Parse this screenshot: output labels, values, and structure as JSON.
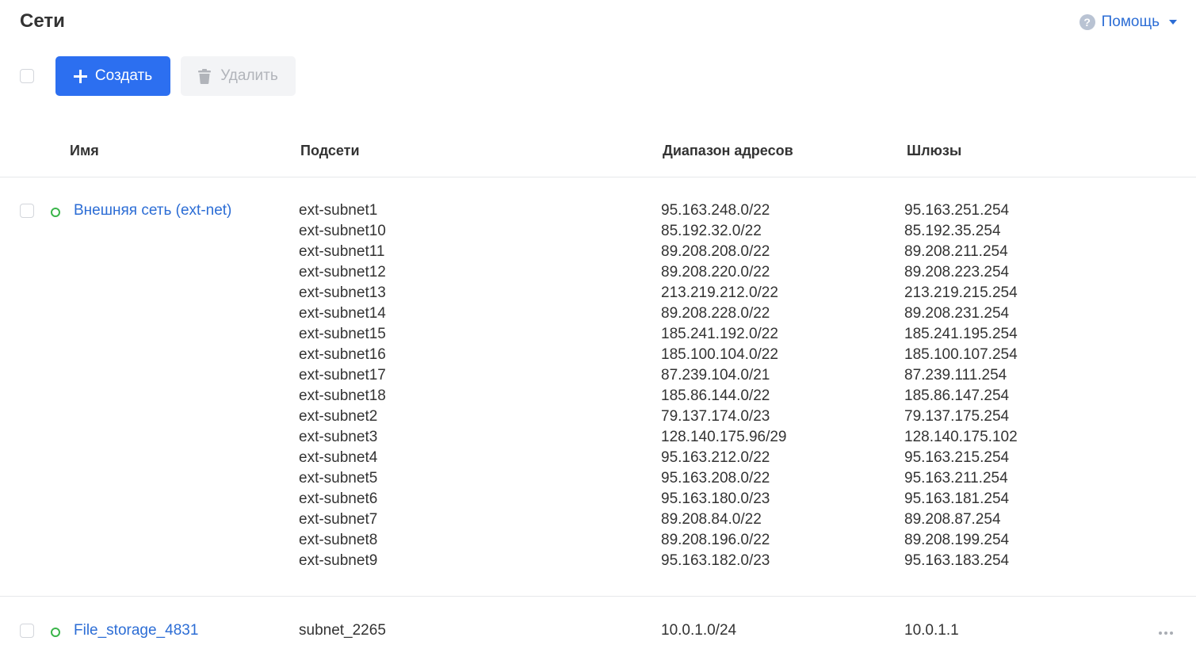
{
  "header": {
    "title": "Сети",
    "help_label": "Помощь"
  },
  "toolbar": {
    "create_label": "Создать",
    "delete_label": "Удалить"
  },
  "table": {
    "columns": [
      "Имя",
      "Подсети",
      "Диапазон адресов",
      "Шлюзы"
    ],
    "rows": [
      {
        "name": "Внешняя сеть (ext-net)",
        "subnets": [
          "ext-subnet1",
          "ext-subnet10",
          "ext-subnet11",
          "ext-subnet12",
          "ext-subnet13",
          "ext-subnet14",
          "ext-subnet15",
          "ext-subnet16",
          "ext-subnet17",
          "ext-subnet18",
          "ext-subnet2",
          "ext-subnet3",
          "ext-subnet4",
          "ext-subnet5",
          "ext-subnet6",
          "ext-subnet7",
          "ext-subnet8",
          "ext-subnet9"
        ],
        "ranges": [
          "95.163.248.0/22",
          "85.192.32.0/22",
          "89.208.208.0/22",
          "89.208.220.0/22",
          "213.219.212.0/22",
          "89.208.228.0/22",
          "185.241.192.0/22",
          "185.100.104.0/22",
          "87.239.104.0/21",
          "185.86.144.0/22",
          "79.137.174.0/23",
          "128.140.175.96/29",
          "95.163.212.0/22",
          "95.163.208.0/22",
          "95.163.180.0/23",
          "89.208.84.0/22",
          "89.208.196.0/22",
          "95.163.182.0/23"
        ],
        "gateways": [
          "95.163.251.254",
          "85.192.35.254",
          "89.208.211.254",
          "89.208.223.254",
          "213.219.215.254",
          "89.208.231.254",
          "185.241.195.254",
          "185.100.107.254",
          "87.239.111.254",
          "185.86.147.254",
          "79.137.175.254",
          "128.140.175.102",
          "95.163.215.254",
          "95.163.211.254",
          "95.163.181.254",
          "89.208.87.254",
          "89.208.199.254",
          "95.163.183.254"
        ]
      },
      {
        "name": "File_storage_4831",
        "subnets": [
          "subnet_2265"
        ],
        "ranges": [
          "10.0.1.0/24"
        ],
        "gateways": [
          "10.0.1.1"
        ]
      }
    ]
  },
  "colors": {
    "accent": "#2c6ff0",
    "link": "#2c6dd5",
    "status_active": "#3ab54a"
  },
  "icons": [
    "help-icon",
    "chevron-down-icon",
    "plus-icon",
    "trash-icon",
    "status-active-icon",
    "more-icon"
  ]
}
